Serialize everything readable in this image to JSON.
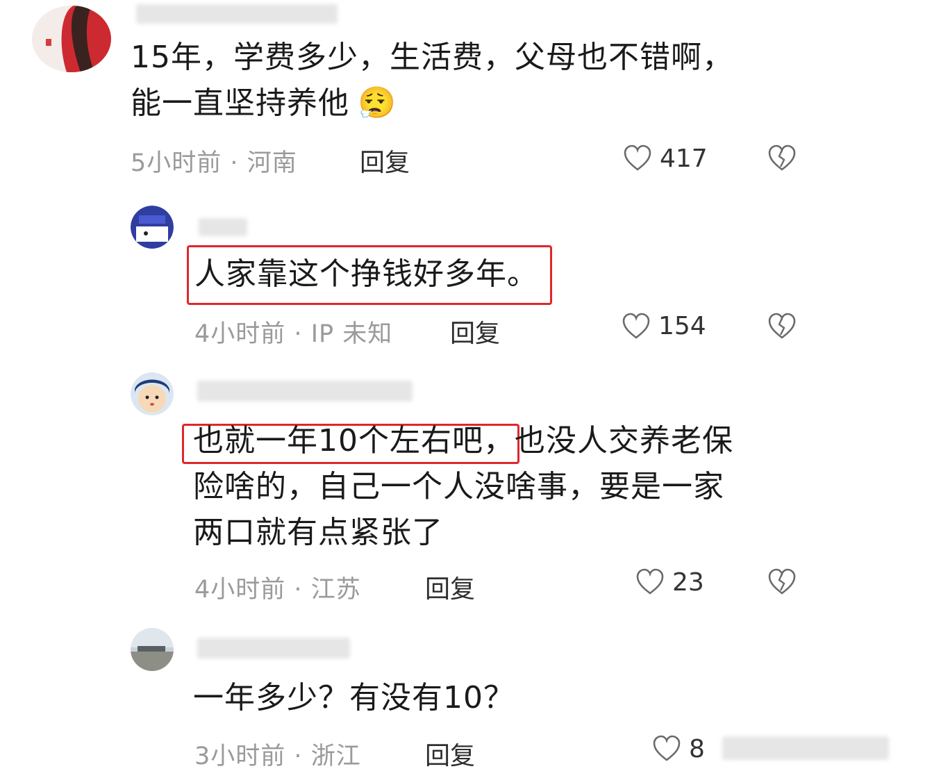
{
  "comments": [
    {
      "text_lines": [
        "15年，学费多少，生活费，父母也不错啊，",
        "能一直坚持养他"
      ],
      "emoji": "😮‍💨",
      "time": "5小时前",
      "location": "河南",
      "reply_label": "回复",
      "likes": "417"
    },
    {
      "text_lines": [
        "人家靠这个挣钱好多年。"
      ],
      "time": "4小时前",
      "location": "IP 未知",
      "reply_label": "回复",
      "likes": "154"
    },
    {
      "text_lines": [
        "也就一年10个左右吧，也没人交养老保",
        "险啥的，自己一个人没啥事，要是一家",
        "两口就有点紧张了"
      ],
      "time": "4小时前",
      "location": "江苏",
      "reply_label": "回复",
      "likes": "23"
    },
    {
      "text_lines": [
        "一年多少？有没有10？"
      ],
      "time": "3小时前",
      "location": "浙江",
      "reply_label": "回复",
      "likes": "8"
    }
  ],
  "meta_separator": "·",
  "colors": {
    "highlight": "#e0262b",
    "meta": "#9a9a9a"
  }
}
